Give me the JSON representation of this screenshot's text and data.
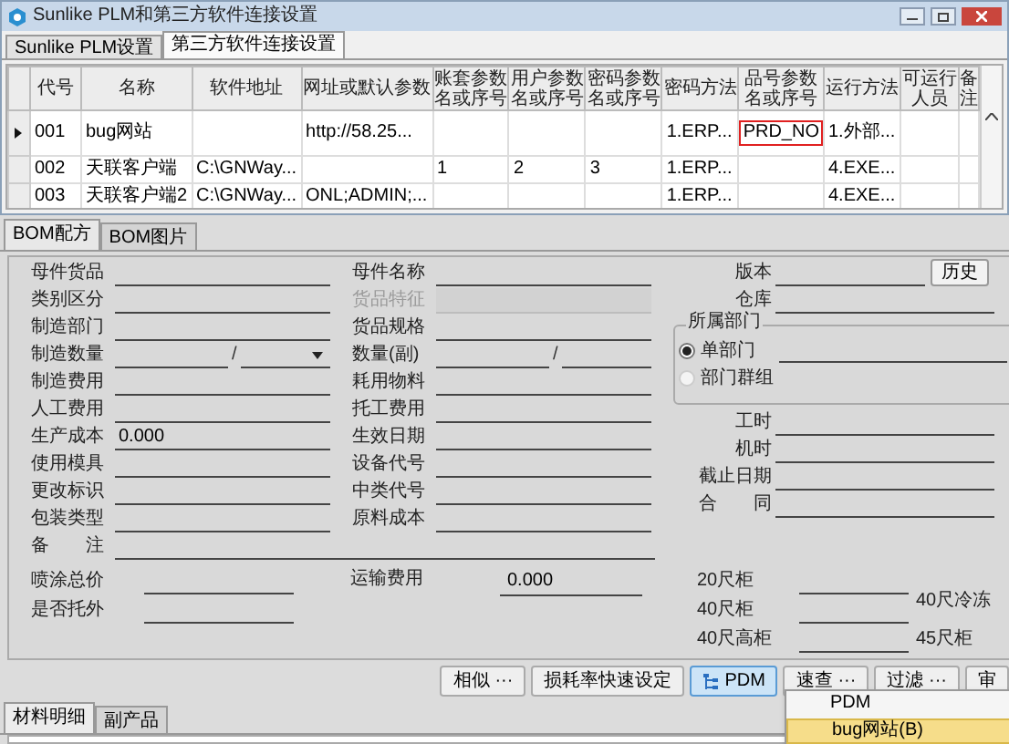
{
  "window": {
    "title": "Sunlike PLM和第三方软件连接设置",
    "tabs": [
      {
        "label": "Sunlike PLM设置",
        "selected": false
      },
      {
        "label": "第三方软件连接设置",
        "selected": true
      }
    ]
  },
  "grid": {
    "columns": [
      "代号",
      "名称",
      "软件地址",
      "网址或默认参数",
      "账套参数名或序号",
      "用户参数名或序号",
      "密码参数名或序号",
      "密码方法",
      "品号参数名或序号",
      "运行方法",
      "可运行人员",
      "备注"
    ],
    "rows": [
      {
        "current": true,
        "cells": [
          {
            "text": "001",
            "outlined": false
          },
          {
            "text": "bug网站",
            "outlined": false
          },
          null,
          {
            "text": "http://58.25...",
            "outlined": false
          },
          null,
          null,
          null,
          {
            "text": "1.ERP...",
            "outlined": false
          },
          {
            "text": "PRD_NO",
            "outlined": true
          },
          {
            "text": "1.外部...",
            "outlined": false
          },
          null,
          null
        ]
      },
      {
        "current": false,
        "cells": [
          {
            "text": "002",
            "outlined": false
          },
          {
            "text": "天联客户端",
            "outlined": false
          },
          {
            "text": "C:\\GNWay...",
            "outlined": false
          },
          null,
          {
            "text": "1",
            "outlined": false
          },
          {
            "text": "2",
            "outlined": false
          },
          {
            "text": "3",
            "outlined": false
          },
          {
            "text": "1.ERP...",
            "outlined": false
          },
          null,
          {
            "text": "4.EXE...",
            "outlined": false
          },
          null,
          null
        ]
      },
      {
        "current": false,
        "cells": [
          {
            "text": "003",
            "outlined": false
          },
          {
            "text": "天联客户端2",
            "outlined": false
          },
          {
            "text": "C:\\GNWay...",
            "outlined": false
          },
          {
            "text": "ONL;ADMIN;...",
            "outlined": false
          },
          null,
          null,
          null,
          {
            "text": "1.ERP...",
            "outlined": false
          },
          null,
          {
            "text": "4.EXE...",
            "outlined": false
          },
          null,
          null
        ]
      }
    ]
  },
  "bom": {
    "tabs": [
      {
        "label": "BOM配方",
        "selected": true
      },
      {
        "label": "BOM图片",
        "selected": false
      }
    ],
    "left_fields": [
      {
        "label": "母件货品",
        "kind": "line",
        "disabled": false
      },
      {
        "label": "类别区分",
        "kind": "line",
        "disabled": false
      },
      {
        "label": "制造部门",
        "kind": "line",
        "disabled": false
      },
      {
        "label": "制造数量",
        "kind": "split",
        "separator": "/",
        "dropdown": true,
        "disabled": false
      },
      {
        "label": "制造费用",
        "kind": "line",
        "disabled": false
      },
      {
        "label": "人工费用",
        "kind": "line",
        "disabled": false
      },
      {
        "label": "生产成本",
        "kind": "line",
        "value": "0.000",
        "disabled": false
      },
      {
        "label": "使用模具",
        "kind": "line",
        "disabled": false
      },
      {
        "label": "更改标识",
        "kind": "line",
        "disabled": false
      },
      {
        "label": "包装类型",
        "kind": "line",
        "disabled": false
      }
    ],
    "middle_fields": [
      {
        "label": "母件名称",
        "kind": "line",
        "disabled": false
      },
      {
        "label": "货品特征",
        "kind": "line",
        "disabled": true
      },
      {
        "label": "货品规格",
        "kind": "line",
        "disabled": false
      },
      {
        "label": "数量(副)",
        "kind": "split",
        "separator": "/",
        "dropdown": false,
        "disabled": false
      },
      {
        "label": "耗用物料",
        "kind": "line",
        "disabled": false
      },
      {
        "label": "托工费用",
        "kind": "line",
        "disabled": false
      },
      {
        "label": "生效日期",
        "kind": "line",
        "disabled": false
      },
      {
        "label": "设备代号",
        "kind": "line",
        "disabled": false
      },
      {
        "label": "中类代号",
        "kind": "line",
        "disabled": false
      },
      {
        "label": "原料成本",
        "kind": "line",
        "disabled": false
      }
    ],
    "version": {
      "label": "版本",
      "button": "历史"
    },
    "warehouse": {
      "label": "仓库"
    },
    "dept_group": {
      "title": "所属部门",
      "options": [
        {
          "label": "单部门",
          "selected": true
        },
        {
          "label": "部门群组",
          "selected": false
        }
      ]
    },
    "right_fields": [
      {
        "label": "工时"
      },
      {
        "label": "机时"
      },
      {
        "label": "截止日期"
      },
      {
        "label": "合　　同"
      }
    ],
    "remark": {
      "label": "备　　注"
    },
    "extra_left": [
      {
        "label": "喷涂总价"
      },
      {
        "label": "是否托外"
      }
    ],
    "freight": {
      "label": "运输费用",
      "value": "0.000"
    },
    "containers": [
      {
        "label": "20尺柜"
      },
      {
        "label": "40尺柜"
      },
      {
        "label": "40尺高柜"
      }
    ],
    "containers_right": [
      {
        "label": "40尺冷冻"
      },
      {
        "label": "45尺柜"
      }
    ],
    "buttons": [
      {
        "label": "相似 ···",
        "pressed": false,
        "kind": "text"
      },
      {
        "label": "损耗率快速设定",
        "pressed": false,
        "kind": "text"
      },
      {
        "label": "PDM",
        "pressed": true,
        "kind": "tree"
      },
      {
        "label": "速查 ···",
        "pressed": false,
        "kind": "text"
      },
      {
        "label": "过滤 ···",
        "pressed": false,
        "kind": "text"
      },
      {
        "label": "审",
        "pressed": false,
        "kind": "text"
      }
    ],
    "menu": [
      {
        "label": "PDM",
        "selected": false
      },
      {
        "label": "bug网站(B)",
        "selected": true
      }
    ],
    "detail_tabs": [
      {
        "label": "材料明细",
        "selected": true
      },
      {
        "label": "副产品",
        "selected": false
      }
    ]
  }
}
